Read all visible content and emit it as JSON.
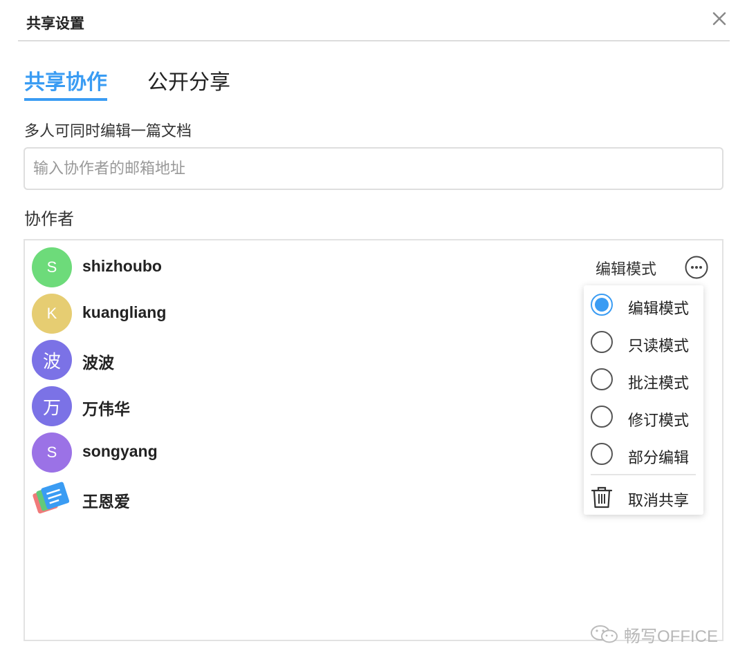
{
  "dialog": {
    "title": "共享设置",
    "close_icon": "close-icon"
  },
  "tabs": [
    {
      "label": "共享协作",
      "active": true
    },
    {
      "label": "公开分享",
      "active": false
    }
  ],
  "description": "多人可同时编辑一篇文档",
  "email_input": {
    "value": "",
    "placeholder": "输入协作者的邮箱地址"
  },
  "collaborators_label": "协作者",
  "collaborators": [
    {
      "initial": "S",
      "name": "shizhoubo",
      "avatar_color": "#6ddb7a"
    },
    {
      "initial": "K",
      "name": "kuangliang",
      "avatar_color": "#e6cd72"
    },
    {
      "initial": "波",
      "name": "波波",
      "avatar_color": "#7b72e6"
    },
    {
      "initial": "万",
      "name": "万伟华",
      "avatar_color": "#7b72e6"
    },
    {
      "initial": "S",
      "name": "songyang",
      "avatar_color": "#9b72e6"
    },
    {
      "initial": "",
      "name": "王恩爱",
      "avatar_icon": "app-logo-icon"
    }
  ],
  "current_mode": "编辑模式",
  "mode_menu": {
    "options": [
      {
        "label": "编辑模式",
        "checked": true
      },
      {
        "label": "只读模式",
        "checked": false
      },
      {
        "label": "批注模式",
        "checked": false
      },
      {
        "label": "修订模式",
        "checked": false
      },
      {
        "label": "部分编辑",
        "checked": false
      }
    ],
    "cancel_label": "取消共享",
    "cancel_icon": "trash-icon"
  },
  "watermark": "畅写OFFICE",
  "colors": {
    "accent": "#3a9cf3",
    "border": "#dedede"
  }
}
